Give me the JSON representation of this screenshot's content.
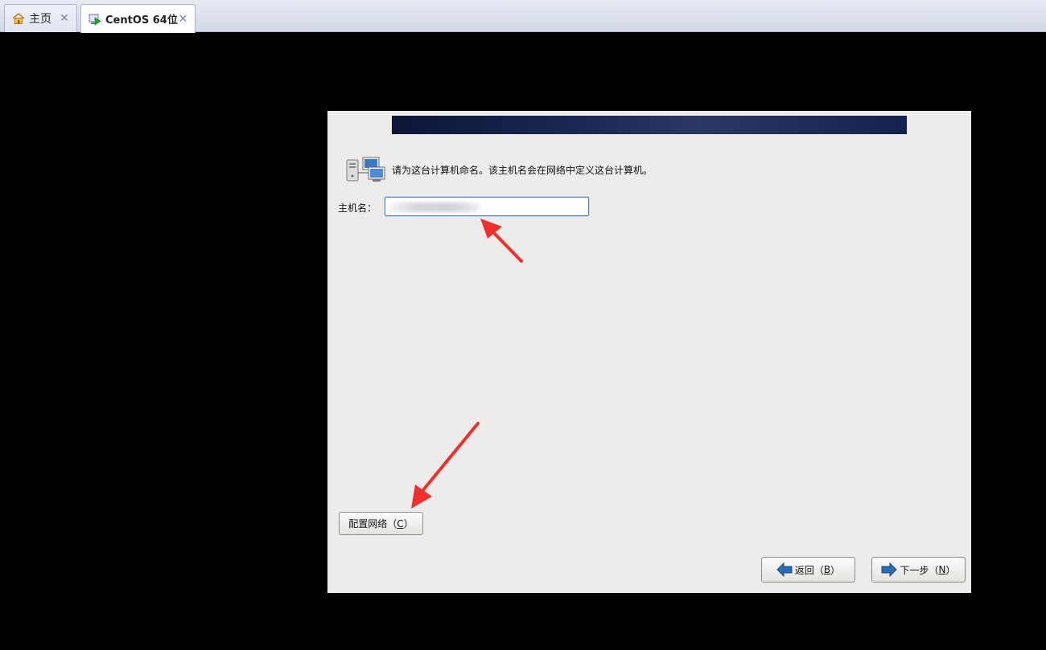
{
  "tabs": [
    {
      "label": "主页",
      "icon": "home-icon",
      "close": "✕"
    },
    {
      "label": "CentOS 64位",
      "icon": "vm-running-icon",
      "close": "✕",
      "active": true
    }
  ],
  "installer": {
    "prompt": "请为这台计算机命名。该主机名会在网络中定义这台计算机。",
    "prompt_icon": "network-computers-icon",
    "hostname_label": "主机名：",
    "hostname_value": "",
    "configure_network_button": {
      "label": "配置网络（",
      "mnemonic": "C",
      "suffix": "）"
    },
    "back_button": {
      "label": "返回（",
      "mnemonic": "B",
      "suffix": "）"
    },
    "next_button": {
      "label": "下一步（",
      "mnemonic": "N",
      "suffix": "）"
    }
  },
  "colors": {
    "annotation_arrow": "#f0302c",
    "banner_dark": "#0d1638",
    "installer_bg": "#edecea",
    "button_arrow": "#2b6cb5"
  }
}
